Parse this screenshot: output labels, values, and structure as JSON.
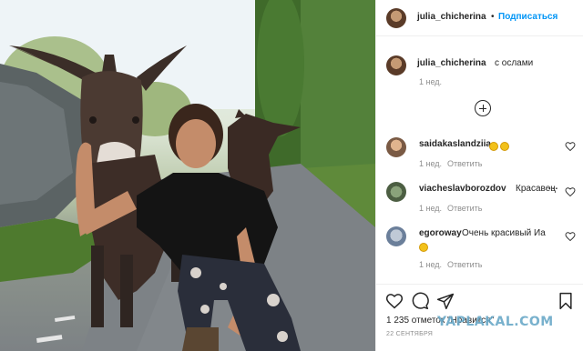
{
  "post": {
    "author": "julia_chicherina",
    "dot": "•",
    "follow_label": "Подписаться",
    "more": "...",
    "caption_author": "julia_chicherina",
    "caption_text": "с ослами",
    "caption_age": "1 нед."
  },
  "comments": [
    {
      "author": "saidakaslandziia",
      "text": "",
      "emoji": [
        "clapping-emoji",
        "smiling-emoji"
      ],
      "age": "1 нед.",
      "reply_label": "Ответить"
    },
    {
      "author": "viacheslavborozdov",
      "text": "Красавец",
      "age": "1 нед.",
      "reply_label": "Ответить",
      "more": "..."
    },
    {
      "author": "egoroway",
      "text": "Очень красивый Иа",
      "emoji": [
        "grinning-emoji"
      ],
      "age": "1 нед.",
      "reply_label": "Ответить"
    }
  ],
  "actions": {
    "likes_text": "1 235 отметок \"Нравится\"",
    "date": "22 СЕНТЯБРЯ"
  },
  "watermark": "YAPLAKAL.COM",
  "colors": {
    "accent": "#0095f6",
    "text": "#262626",
    "muted": "#8e8e8e",
    "watermark": "#6aa9c8"
  },
  "icons": {
    "like": "heart-icon",
    "comment": "comment-icon",
    "share": "paper-plane-icon",
    "save": "bookmark-icon",
    "load_more": "plus-circle-icon"
  }
}
